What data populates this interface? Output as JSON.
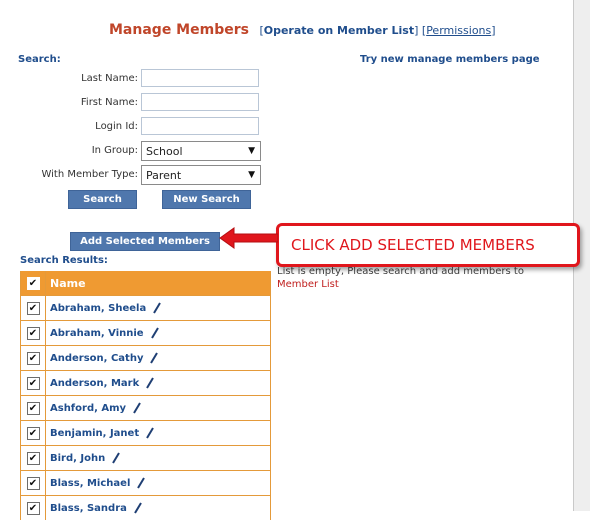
{
  "header": {
    "title": "Manage Members",
    "operate_link": "Operate on Member List",
    "permissions_link": "Permissions"
  },
  "search": {
    "label": "Search:",
    "try_new_link": "Try new manage members page",
    "last_name_label": "Last Name:",
    "last_name_value": "",
    "first_name_label": "First Name:",
    "first_name_value": "",
    "login_id_label": "Login Id:",
    "login_id_value": "",
    "in_group_label": "In Group:",
    "in_group_value": "School",
    "member_type_label": "With Member Type:",
    "member_type_value": "Parent",
    "search_button": "Search",
    "new_search_button": "New Search",
    "add_selected_button": "Add Selected Members"
  },
  "results": {
    "label": "Search Results:",
    "column_name": "Name",
    "rows": [
      {
        "name": "Abraham, Sheela",
        "checked": true
      },
      {
        "name": "Abraham, Vinnie",
        "checked": true
      },
      {
        "name": "Anderson, Cathy",
        "checked": true
      },
      {
        "name": "Anderson, Mark",
        "checked": true
      },
      {
        "name": "Ashford, Amy",
        "checked": true
      },
      {
        "name": "Benjamin, Janet",
        "checked": true
      },
      {
        "name": "Bird, John",
        "checked": true
      },
      {
        "name": "Blass, Michael",
        "checked": true
      },
      {
        "name": "Blass, Sandra",
        "checked": true
      }
    ]
  },
  "member_list_panel": {
    "empty_text": "List is empty, Please search and add members to",
    "member_list_link": "Member List"
  },
  "annotation": {
    "callout_text": "CLICK ADD SELECTED MEMBERS"
  },
  "colors": {
    "accent_orange": "#ef9a32",
    "button_blue": "#4f77ad",
    "link_blue": "#1f4d8c",
    "title_red": "#c0462a",
    "callout_red": "#e0161c"
  },
  "icons": {
    "checkbox": "checkbox-checked-icon",
    "edit": "pencil-icon",
    "dropdown": "chevron-down-icon"
  }
}
